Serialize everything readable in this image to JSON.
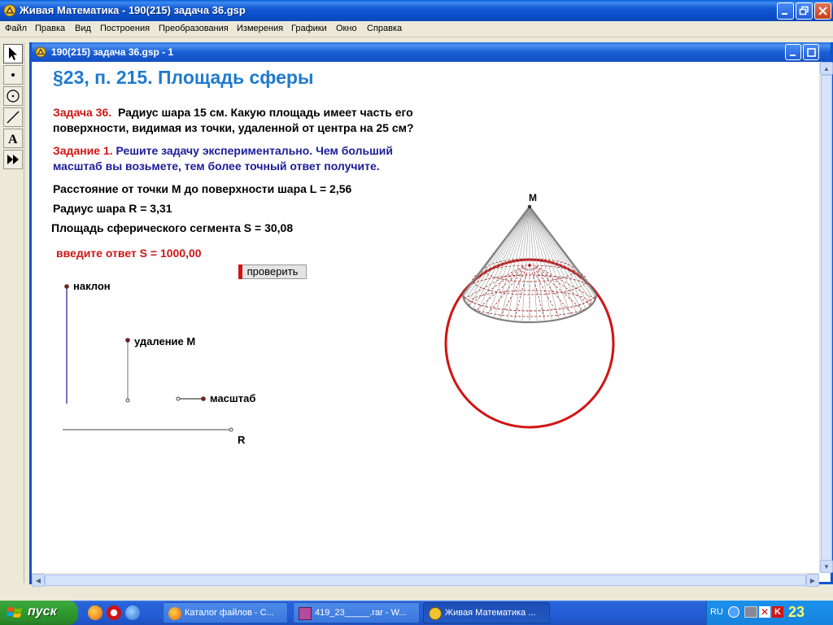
{
  "app": {
    "title": "Живая Математика - 190(215) задача 36.gsp"
  },
  "menu": [
    "Файл",
    "Правка",
    "Вид",
    "Построения",
    "Преобразования",
    "Измерения",
    "Графики",
    "Окно",
    "Справка"
  ],
  "tools": [
    "arrow-tool",
    "point-tool",
    "compass-tool",
    "straightedge-tool",
    "text-tool",
    "custom-tool"
  ],
  "document": {
    "title": "190(215) задача 36.gsp - 1",
    "heading": "§23, п. 215. Площадь сферы",
    "task_label": "Задача 36.",
    "task_text_1": "Радиус шара 15 см. Какую площадь имеет часть его",
    "task_text_2": "поверхности, видимая из точки, удаленной от центра на 25 см?",
    "assign_label": "Задание 1.",
    "assign_text_1": "Решите задачу экспериментально. Чем больший",
    "assign_text_2": "масштаб вы возьмете, тем более точный ответ получите.",
    "distance": "Расстояние от точки М до поверхности шара  L  = 2,56",
    "radius": "Радиус шара R = 3,31",
    "segment_area": "Площадь сферического сегмента  S  = 30,08",
    "answer": "введите ответ  S  = 1000,00",
    "check_button": "проверить",
    "slider_tilt": "наклон",
    "slider_distance": "удаление М",
    "slider_scale": "масштаб",
    "point_r": "R",
    "point_m": "M"
  },
  "colors": {
    "heading": "#1f7ad0",
    "red": "#d01515",
    "navy": "#1c1c9a",
    "circle": "#d01515",
    "cone": "#808080"
  },
  "taskbar": {
    "start": "пуск",
    "tasks": [
      "Каталог файлов - С...",
      "419_23_____.rar - W...",
      "Живая Математика ..."
    ],
    "lang": "RU",
    "clock": "23"
  }
}
